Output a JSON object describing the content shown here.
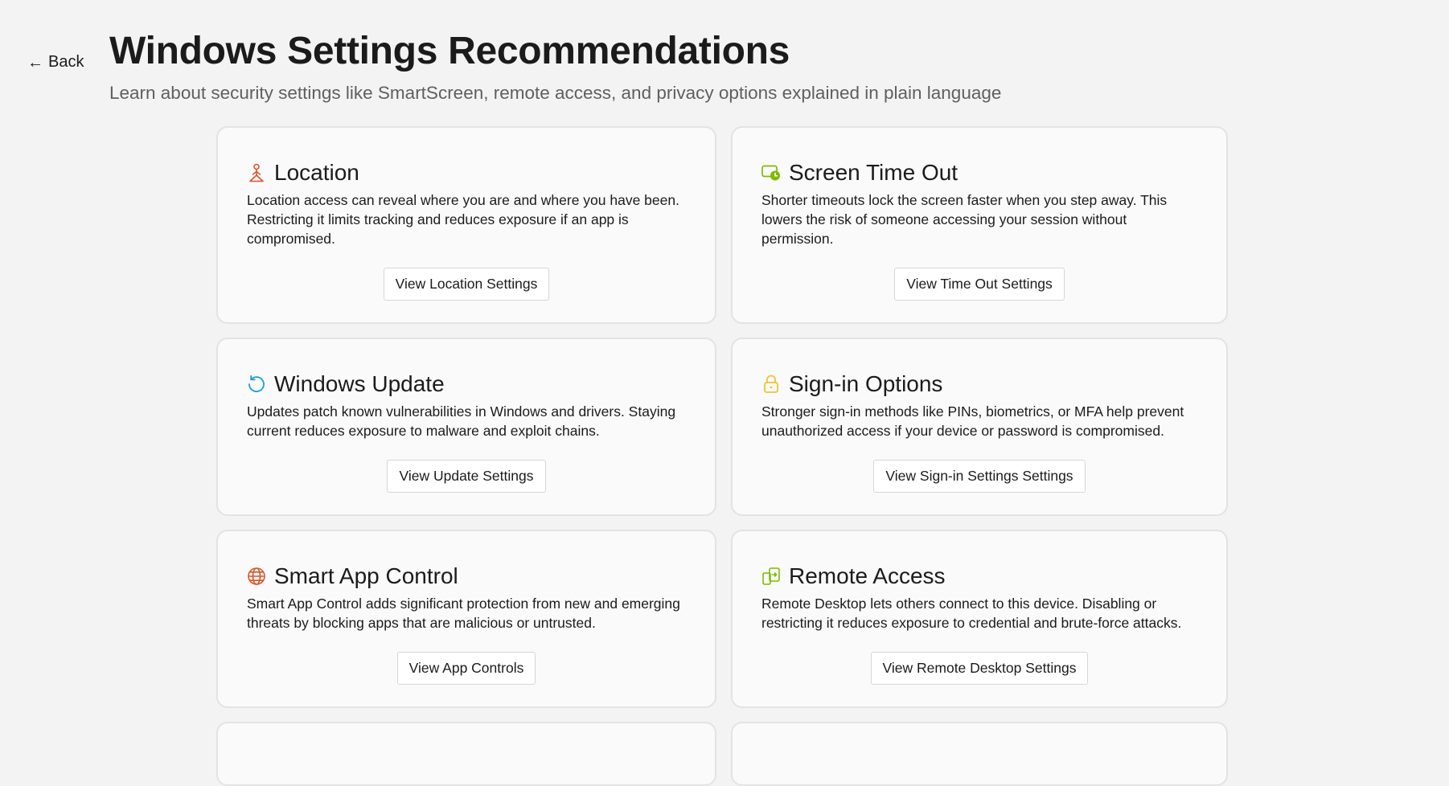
{
  "nav": {
    "back_arrow": "←",
    "back_label": "Back"
  },
  "header": {
    "title": "Windows Settings Recommendations",
    "subtitle": "Learn about security settings like SmartScreen, remote access, and privacy options explained in plain language"
  },
  "colors": {
    "location_icon": "#d9552b",
    "screen_timeout_icon": "#7fba00",
    "windows_update_icon": "#1aa0d8",
    "sign_in_icon": "#f2c230",
    "smart_app_icon": "#d9552b",
    "remote_access_icon": "#7fba00"
  },
  "cards": [
    {
      "icon": "location-person-icon",
      "title": "Location",
      "description": "Location access can reveal where you are and where you have been. Restricting it limits tracking and reduces exposure if an app is compromised.",
      "button": "View Location Settings"
    },
    {
      "icon": "screen-clock-icon",
      "title": "Screen Time Out",
      "description": "Shorter timeouts lock the screen faster when you step away. This lowers the risk of someone accessing your session without permission.",
      "button": "View Time Out Settings"
    },
    {
      "icon": "refresh-icon",
      "title": "Windows Update",
      "description": "Updates patch known vulnerabilities in Windows and drivers. Staying current reduces exposure to malware and exploit chains.",
      "button": "View Update Settings"
    },
    {
      "icon": "lock-icon",
      "title": "Sign-in Options",
      "description": "Stronger sign-in methods like PINs, biometrics, or MFA help prevent unauthorized access if your device or password is compromised.",
      "button": "View Sign-in Settings Settings"
    },
    {
      "icon": "globe-icon",
      "title": "Smart App Control",
      "description": "Smart App Control adds significant protection from new and emerging threats by blocking apps that are malicious or untrusted.",
      "button": "View App Controls"
    },
    {
      "icon": "remote-devices-icon",
      "title": "Remote Access",
      "description": "Remote Desktop lets others connect to this device. Disabling or restricting it reduces exposure to credential and brute-force attacks.",
      "button": "View Remote Desktop Settings"
    }
  ]
}
